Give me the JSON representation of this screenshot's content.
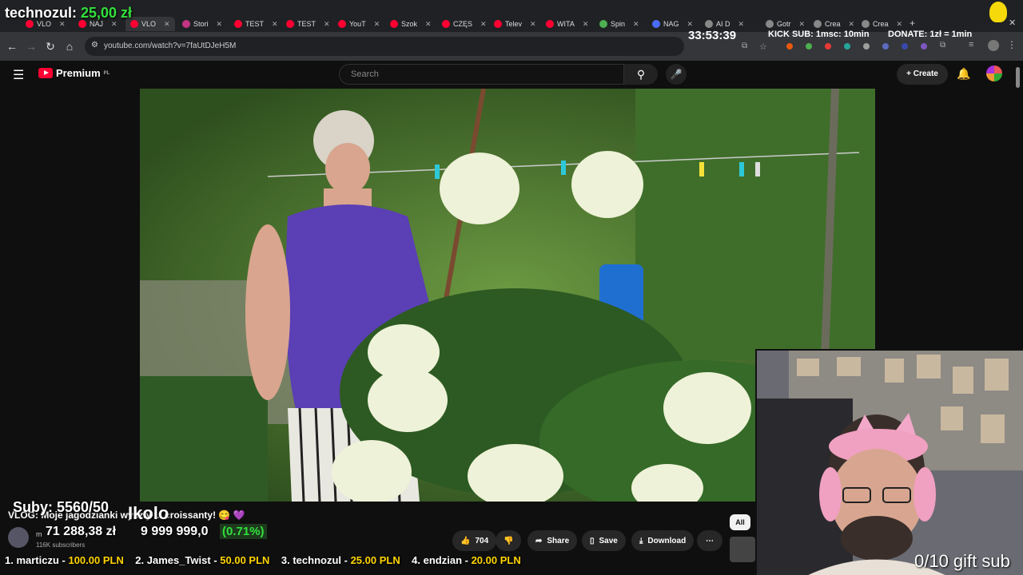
{
  "overlay": {
    "donor_name": "technozul:",
    "donor_amount": "25,00 zł",
    "timer": "33:53:39",
    "kick_sub": "KICK SUB: 1msc: 10min",
    "donate": "DONATE: 1zł = 1min",
    "subs": "Suby: 5560/50",
    "kolo": "Ikolo",
    "money": "71 288,38 zł",
    "target": "9 999 999,0",
    "percent": "(0.71%)",
    "gift": "0/10 gift sub"
  },
  "tabs": [
    {
      "label": "VLO"
    },
    {
      "label": "NAJ"
    },
    {
      "label": "VLO"
    },
    {
      "label": "Stori"
    },
    {
      "label": "TEST"
    },
    {
      "label": "TEST"
    },
    {
      "label": "YouT"
    },
    {
      "label": "Szok"
    },
    {
      "label": "CZĘS"
    },
    {
      "label": "Telev"
    },
    {
      "label": "WITA"
    },
    {
      "label": "Spin"
    },
    {
      "label": "NAG"
    },
    {
      "label": "AI D"
    },
    {
      "label": "Gotr"
    },
    {
      "label": "Crea"
    },
    {
      "label": "Crea"
    }
  ],
  "browser": {
    "url": "youtube.com/watch?v=7faUtDJeH5M"
  },
  "youtube": {
    "logo_text": "Premium",
    "logo_region": "PL",
    "search_placeholder": "Search",
    "create_label": "Create"
  },
  "video": {
    "title": "VLOG: Moje jagodzianki wyszły ... croissanty! 😋 💜",
    "channel_name": "m",
    "subscribers": "116K subscribers",
    "likes": "704",
    "share_label": "Share",
    "save_label": "Save",
    "download_label": "Download",
    "filter_chip": "All"
  },
  "leaderboard": [
    {
      "rank_name": "1. marticzu - ",
      "amount": "100.00 PLN"
    },
    {
      "rank_name": "2. James_Twist - ",
      "amount": "50.00 PLN"
    },
    {
      "rank_name": "3. technozul - ",
      "amount": "25.00 PLN"
    },
    {
      "rank_name": "4. endzian - ",
      "amount": "20.00 PLN"
    }
  ]
}
